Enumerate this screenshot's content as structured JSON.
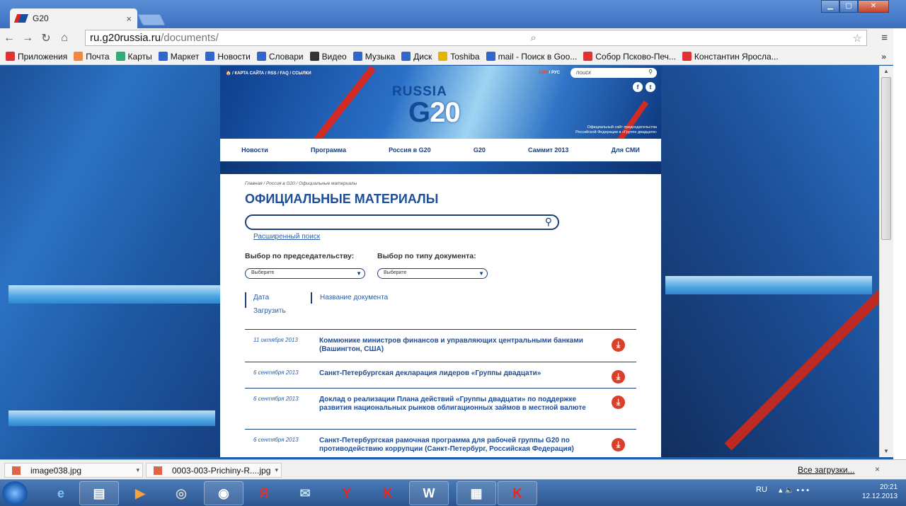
{
  "browser": {
    "tab_title": "G20",
    "tab_close": "×",
    "address_host": "ru.g20russia.ru",
    "address_path": "/documents/",
    "bookmarks": [
      {
        "label": "Приложения",
        "color": "#d33"
      },
      {
        "label": "Почта",
        "color": "#e84"
      },
      {
        "label": "Карты",
        "color": "#3a7"
      },
      {
        "label": "Маркет",
        "color": "#36c"
      },
      {
        "label": "Новости",
        "color": "#36c"
      },
      {
        "label": "Словари",
        "color": "#36c"
      },
      {
        "label": "Видео",
        "color": "#333"
      },
      {
        "label": "Музыка",
        "color": "#36c"
      },
      {
        "label": "Диск",
        "color": "#36c"
      },
      {
        "label": "Toshiba",
        "color": "#e9b000"
      },
      {
        "label": "mail - Поиск в Goo...",
        "color": "#36c"
      },
      {
        "label": "Собор Псково-Печ...",
        "color": "#d33"
      },
      {
        "label": "Константин Яросла...",
        "color": "#d33"
      }
    ],
    "more_bookmarks": "»"
  },
  "site": {
    "top_links": "🏠 / КАРТА САЙТА / RSS / FAQ / ССЫЛКИ",
    "lang_eng": "ENG",
    "lang_rus": " / РУС",
    "search_placeholder": "поиск",
    "social_f": "f",
    "social_t": "t",
    "logo_russia": "RUSSIA",
    "logo_g": "G",
    "logo_20": "20",
    "official_line1": "Официальный сайт председательства",
    "official_line2": "Российской Федерации в «Группе двадцати»",
    "nav": [
      "Новости",
      "Программа",
      "Россия в G20",
      "G20",
      "Саммит 2013",
      "Для СМИ"
    ]
  },
  "documents_page": {
    "breadcrumb": "Главная / Россия в G20 / Официальные материалы",
    "title": "ОФИЦИАЛЬНЫЕ МАТЕРИАЛЫ",
    "advanced_search": "Расширенный поиск",
    "filter_presidency_label": "Выбор по председательству:",
    "filter_type_label": "Выбор по типу документа:",
    "select_placeholder": "Выберите",
    "sort_date": "Дата",
    "sort_name": "Название документа",
    "sort_download": "Загрузить",
    "docs": [
      {
        "date": "11 октября 2013",
        "title": "Коммюнике министров финансов и управляющих центральными банками (Вашингтон, США)"
      },
      {
        "date": "6 сентября 2013",
        "title": "Санкт-Петербургская декларация лидеров «Группы двадцати»"
      },
      {
        "date": "6 сентября 2013",
        "title": "Доклад о реализации Плана действий «Группы двадцати» по поддержке развития национальных рынков облигационных займов в местной валюте"
      },
      {
        "date": "6 сентября 2013",
        "title": "Санкт-Петербургская рамочная программа для рабочей группы G20 по противодействию коррупции (Санкт-Петербург, Российская Федерация)"
      }
    ]
  },
  "download_bar": {
    "items": [
      "image038.jpg",
      "0003-003-Prichiny-R....jpg"
    ],
    "all_downloads": "Все загрузки...",
    "close": "×"
  },
  "taskbar": {
    "lang": "RU",
    "time": "20:21",
    "date": "12.12.2013"
  }
}
